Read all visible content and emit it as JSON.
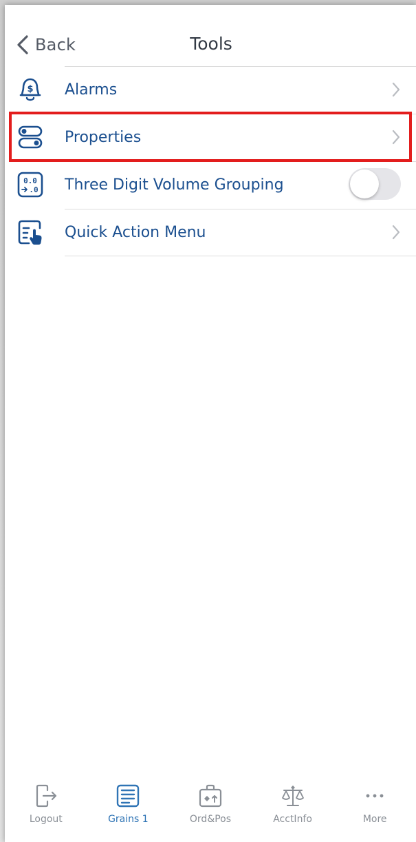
{
  "header": {
    "back_label": "Back",
    "title": "Tools"
  },
  "list": {
    "items": [
      {
        "label": "Alarms",
        "icon": "alarm-bell-dollar-icon",
        "accessory": "chevron"
      },
      {
        "label": "Properties",
        "icon": "toggles-icon",
        "accessory": "chevron"
      },
      {
        "label": "Three Digit Volume Grouping",
        "icon": "digit-grouping-icon",
        "accessory": "toggle",
        "toggle_on": false
      },
      {
        "label": "Quick Action Menu",
        "icon": "quick-action-icon",
        "accessory": "chevron"
      }
    ]
  },
  "tabbar": {
    "tabs": [
      {
        "label": "Logout",
        "icon": "logout-icon",
        "active": false
      },
      {
        "label": "Grains 1",
        "icon": "grains-board-icon",
        "active": true
      },
      {
        "label": "Ord&Pos",
        "icon": "briefcase-icon",
        "active": false
      },
      {
        "label": "AcctInfo",
        "icon": "scale-icon",
        "active": false
      },
      {
        "label": "More",
        "icon": "more-dots-icon",
        "active": false
      }
    ]
  },
  "colors": {
    "accent": "#1b4f8f",
    "active_tab": "#2f74b5",
    "inactive_tab": "#8a8f96",
    "highlight": "#e31d1d"
  }
}
